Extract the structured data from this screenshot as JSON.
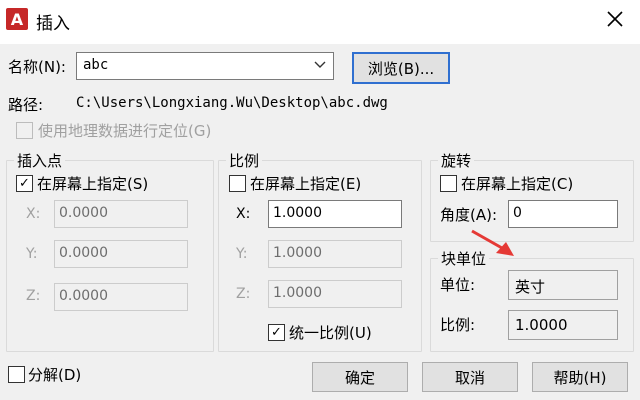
{
  "window": {
    "title": "插入",
    "close_icon": "close-icon"
  },
  "name_row": {
    "label": "名称(N):",
    "value": "abc",
    "browse_label": "浏览(B)..."
  },
  "path_row": {
    "label": "路径:",
    "value": "C:\\Users\\Longxiang.Wu\\Desktop\\abc.dwg"
  },
  "geo_checkbox": {
    "label": "使用地理数据进行定位(G)",
    "checked": false,
    "enabled": false
  },
  "insertion_point": {
    "title": "插入点",
    "specify_label": "在屏幕上指定(S)",
    "specify_checked": true,
    "x_label": "X:",
    "x_value": "0.0000",
    "y_label": "Y:",
    "y_value": "0.0000",
    "z_label": "Z:",
    "z_value": "0.0000"
  },
  "scale": {
    "title": "比例",
    "specify_label": "在屏幕上指定(E)",
    "specify_checked": false,
    "x_label": "X:",
    "x_value": "1.0000",
    "y_label": "Y:",
    "y_value": "1.0000",
    "z_label": "Z:",
    "z_value": "1.0000",
    "uniform_label": "统一比例(U)",
    "uniform_checked": true
  },
  "rotation": {
    "title": "旋转",
    "specify_label": "在屏幕上指定(C)",
    "specify_checked": false,
    "angle_label": "角度(A):",
    "angle_value": "0"
  },
  "block_unit": {
    "title": "块单位",
    "unit_label": "单位:",
    "unit_value": "英寸",
    "factor_label": "比例:",
    "factor_value": "1.0000"
  },
  "explode": {
    "label": "分解(D)",
    "checked": false
  },
  "buttons": {
    "ok": "确定",
    "cancel": "取消",
    "help": "帮助(H)"
  },
  "colors": {
    "accent_border": "#2f6fd0",
    "annotation_arrow": "#e53935",
    "app_icon": "#c62828"
  }
}
